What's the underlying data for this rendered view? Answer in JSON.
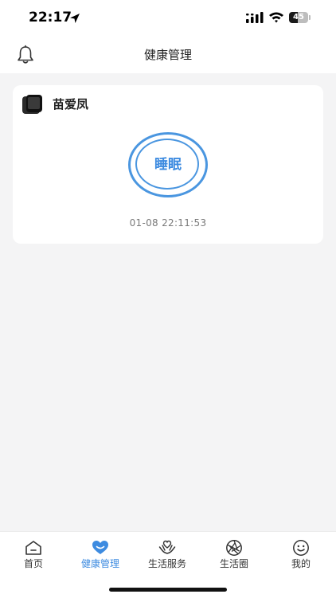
{
  "status_bar": {
    "time": "22:17",
    "battery_level": "45",
    "location_icon": "location-arrow-icon",
    "signal_icon": "cellular-signal-icon",
    "wifi_icon": "wifi-icon"
  },
  "header": {
    "title": "健康管理",
    "bell_icon": "bell-icon"
  },
  "device_card": {
    "device_icon": "watch-device-icon",
    "device_name": "苗爱凤",
    "mode_label": "睡眠",
    "timestamp": "01-08 22:11:53"
  },
  "tabbar": {
    "tabs": [
      {
        "label": "首页",
        "icon": "home-icon",
        "active": false
      },
      {
        "label": "健康管理",
        "icon": "heart-icon",
        "active": true
      },
      {
        "label": "生活服务",
        "icon": "hands-heart-icon",
        "active": false
      },
      {
        "label": "生活圈",
        "icon": "aperture-icon",
        "active": false
      },
      {
        "label": "我的",
        "icon": "smiley-icon",
        "active": false
      }
    ]
  },
  "colors": {
    "accent": "#3d8be0",
    "background": "#f4f4f5",
    "card": "#ffffff"
  }
}
